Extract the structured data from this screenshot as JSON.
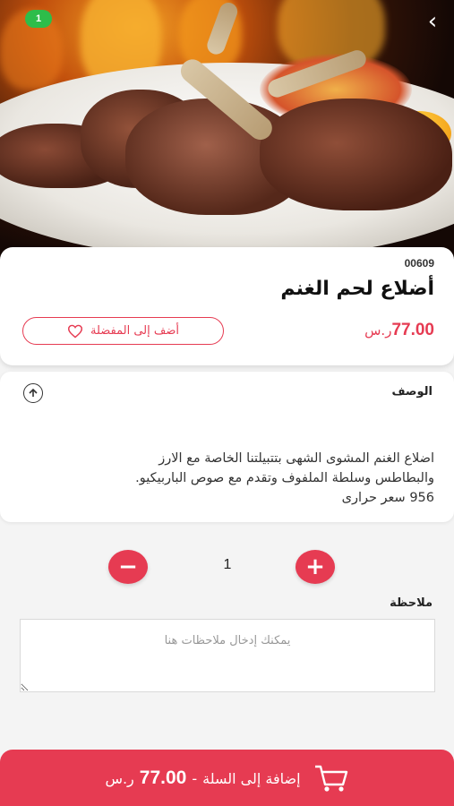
{
  "hero": {
    "cart_count": "1",
    "back_glyph": "‹",
    "icons": {
      "back": "chevron-back-icon"
    }
  },
  "product": {
    "code": "00609",
    "title": "أضلاع لحم الغنم",
    "price": "77.00",
    "currency": "ر.س",
    "favorite_label": "أضف إلى المفضلة"
  },
  "description": {
    "heading": "الوصف",
    "text": "اضلاع الغنم المشوى الشهى بتتبيلتنا الخاصة مع الارز\nوالبطاطس وسلطة الملفوف وتقدم مع صوص الباربيكيو.\n956 سعر حرارى"
  },
  "quantity": {
    "value": "1",
    "minus": "−",
    "plus": "+"
  },
  "notes": {
    "label": "ملاحظة",
    "placeholder": "يمكنك إدخال ملاحظات هنا",
    "value": ""
  },
  "add_to_cart": {
    "label": "إضافة إلى السلة",
    "separator": "-",
    "price": "77.00",
    "currency": "ر.س"
  },
  "colors": {
    "accent": "#e63b52",
    "badge": "#2dbd4a"
  }
}
